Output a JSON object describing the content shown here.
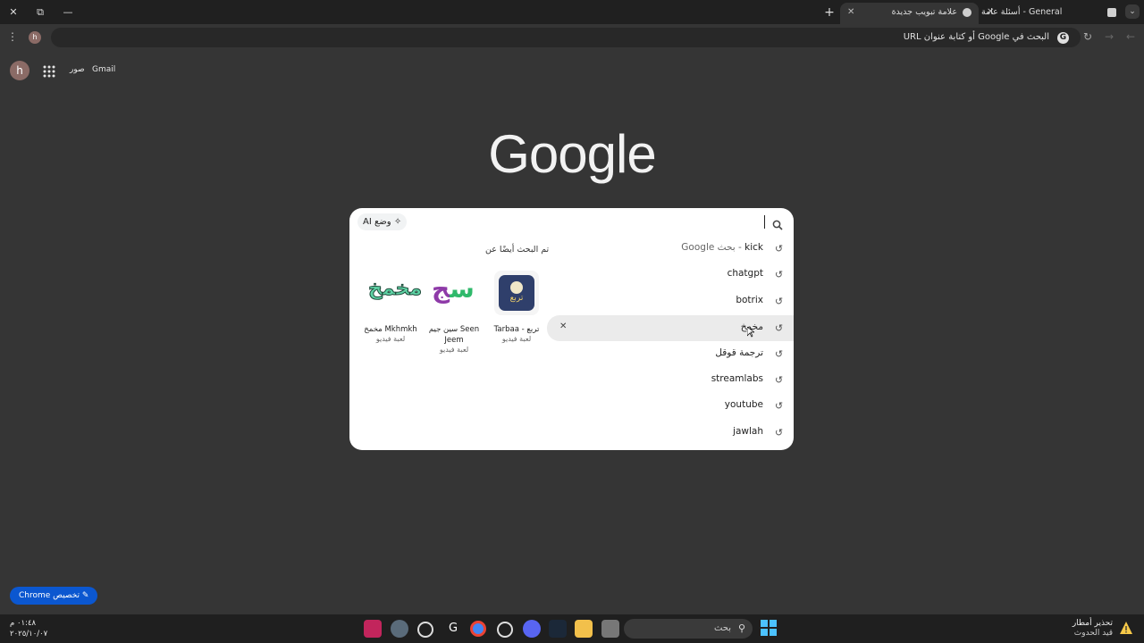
{
  "window": {
    "tabs": [
      {
        "label": "أسئلة عامة - General Questions",
        "active": false
      },
      {
        "label": "علامة تبويب جديدة",
        "active": true
      }
    ],
    "new_tab": "+",
    "controls": {
      "close": "✕",
      "restore": "⧉",
      "minimize": "—"
    }
  },
  "toolbar": {
    "omnibox_placeholder": "البحث في Google أو كتابة عنوان URL",
    "profile_initial": "h"
  },
  "ntp": {
    "gmail": "Gmail",
    "images": "صور",
    "avatar": "h",
    "logo": "Google",
    "customize": "تخصيص Chrome"
  },
  "search": {
    "ai_mode": "وضع AI",
    "suggestions": [
      {
        "text": "kick",
        "sub": " - بحث Google"
      },
      {
        "text": "chatgpt",
        "sub": ""
      },
      {
        "text": "botrix",
        "sub": ""
      },
      {
        "text": "مخمخ",
        "sub": ""
      },
      {
        "text": "ترجمة قوقل",
        "sub": ""
      },
      {
        "text": "streamlabs",
        "sub": ""
      },
      {
        "text": "youtube",
        "sub": ""
      },
      {
        "text": "jawlah",
        "sub": ""
      }
    ],
    "remove_icon": "✕",
    "related_title": "تم البحث أيضًا عن",
    "related": [
      {
        "name": "Tarbaa - تربع",
        "type": "لعبة فيديو",
        "logo_text": "تربع",
        "color": "#2f3f6b"
      },
      {
        "name": "سين جيم Seen Jeem",
        "type": "لعبة فيديو",
        "logo_text": "سج",
        "color": "#ffffff"
      },
      {
        "name": "مخمخ Mkhmkh",
        "type": "لعبة فيديو",
        "logo_text": "مخمخ",
        "color": "#ffffff"
      }
    ]
  },
  "taskbar": {
    "search_placeholder": "بحث",
    "weather_title": "تحذير أمطار",
    "weather_sub": "قيد الحدوث",
    "time": "٠١:٤٨ م",
    "date": "٢٠٢٥/١٠/٠٧"
  }
}
